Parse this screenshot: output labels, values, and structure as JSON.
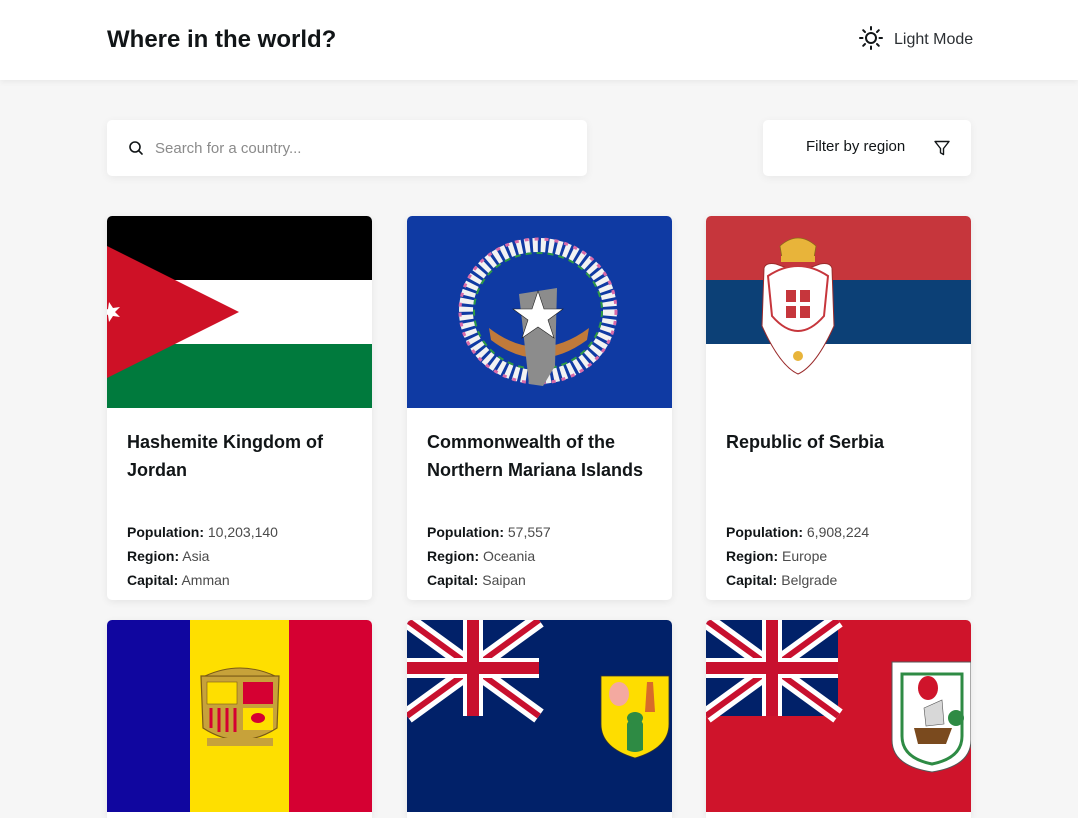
{
  "header": {
    "title": "Where in the world?",
    "mode_label": "Light Mode",
    "mode_icon": "sun-icon"
  },
  "search": {
    "placeholder": "Search for a country...",
    "value": ""
  },
  "filter": {
    "label": "Filter by region",
    "icon": "filter-icon"
  },
  "labels": {
    "population": "Population:",
    "region": "Region:",
    "capital": "Capital:"
  },
  "countries": [
    {
      "name": "Hashemite Kingdom of Jordan",
      "population": "10,203,140",
      "region": "Asia",
      "capital": "Amman",
      "flag": "jordan-flag"
    },
    {
      "name": "Commonwealth of the Northern Mariana Islands",
      "population": "57,557",
      "region": "Oceania",
      "capital": "Saipan",
      "flag": "northern-mariana-islands-flag"
    },
    {
      "name": "Republic of Serbia",
      "population": "6,908,224",
      "region": "Europe",
      "capital": "Belgrade",
      "flag": "serbia-flag"
    },
    {
      "name": "",
      "population": "",
      "region": "",
      "capital": "",
      "flag": "andorra-flag"
    },
    {
      "name": "",
      "population": "",
      "region": "",
      "capital": "",
      "flag": "turks-and-caicos-flag"
    },
    {
      "name": "",
      "population": "",
      "region": "",
      "capital": "",
      "flag": "bermuda-flag"
    }
  ],
  "colors": {
    "background": "#f6f6f6",
    "surface": "#ffffff",
    "text": "#111517"
  }
}
